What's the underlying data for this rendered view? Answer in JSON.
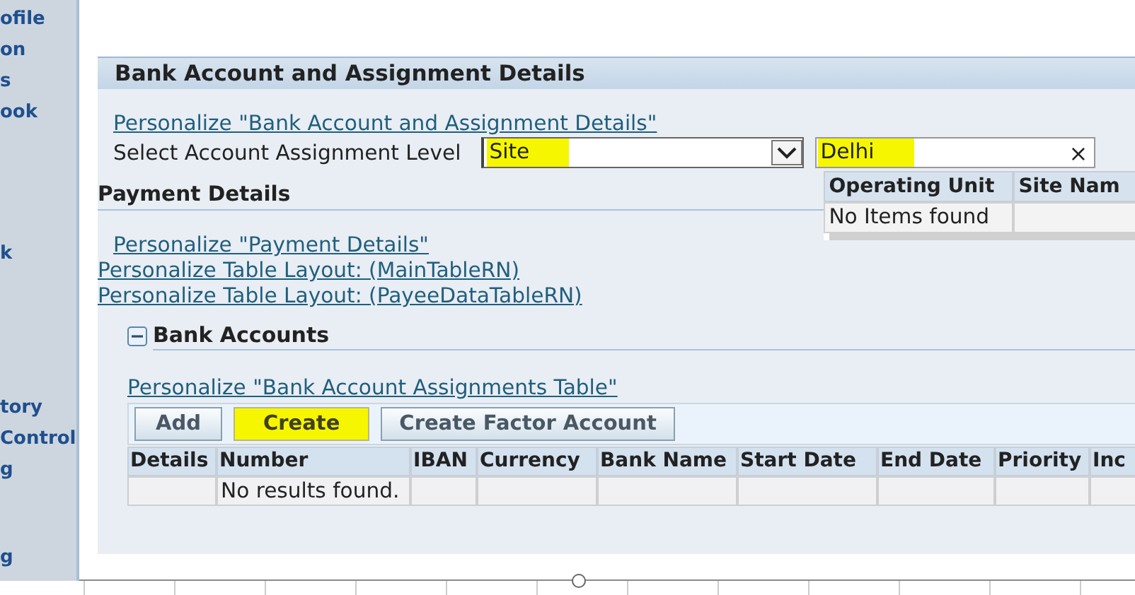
{
  "sidebar": {
    "items": [
      "ofile",
      "on",
      "s",
      "ook",
      "k",
      "tory",
      "Control",
      "g",
      "g"
    ]
  },
  "section": {
    "title": "Bank Account and Assignment Details",
    "personalize_link": "Personalize \"Bank Account and Assignment Details\"",
    "assignment_level": {
      "label": "Select Account Assignment Level",
      "value": "Site",
      "highlighted": true
    },
    "search_field": {
      "value": "Delhi",
      "highlighted": true,
      "clear": "×"
    },
    "popup": {
      "columns": [
        "Operating Unit",
        "Site Nam"
      ],
      "empty_message": "No Items found"
    }
  },
  "payment": {
    "title": "Payment Details",
    "links": [
      {
        "text": "Personalize \"Payment Details\"",
        "indented": true
      },
      {
        "text": "Personalize Table Layout: (MainTableRN)",
        "indented": false
      },
      {
        "text": "Personalize Table Layout: (PayeeDataTableRN)",
        "indented": false
      }
    ]
  },
  "bank_accounts": {
    "title": "Bank Accounts",
    "expanded": true,
    "personalize_link": "Personalize \"Bank Account Assignments Table\"",
    "buttons": [
      {
        "label": "Add",
        "highlighted": false
      },
      {
        "label": "Create",
        "highlighted": true
      },
      {
        "label": "Create Factor Account",
        "highlighted": false
      }
    ],
    "columns": [
      "Details",
      "Number",
      "IBAN",
      "Currency",
      "Bank Name",
      "Start Date",
      "End Date",
      "Priority",
      "Inc"
    ],
    "empty_message": "No results found."
  }
}
